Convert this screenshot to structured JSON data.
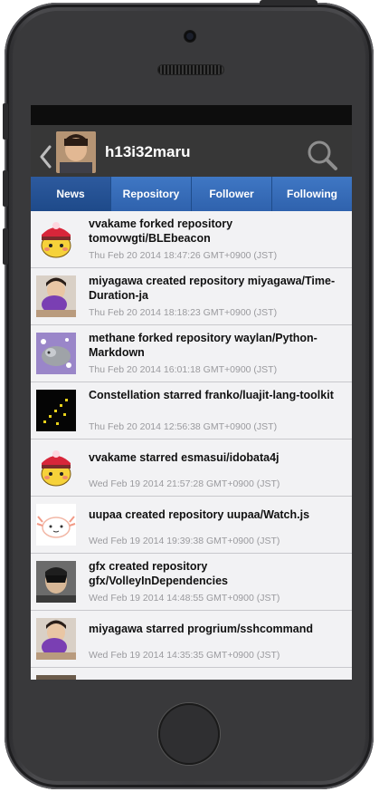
{
  "header": {
    "username": "h13i32maru"
  },
  "tabs": [
    {
      "label": "News",
      "active": true
    },
    {
      "label": "Repository",
      "active": false
    },
    {
      "label": "Follower",
      "active": false
    },
    {
      "label": "Following",
      "active": false
    }
  ],
  "feed": [
    {
      "title": "vvakame forked repository tomovwgti/BLEbeacon",
      "date": "Thu Feb 20 2014 18:47:26 GMT+0900 (JST)",
      "avatar": "yellow-mascot"
    },
    {
      "title": "miyagawa created repository miyagawa/Time-Duration-ja",
      "date": "Thu Feb 20 2014 18:18:23 GMT+0900 (JST)",
      "avatar": "person-purple"
    },
    {
      "title": "methane forked repository waylan/Python-Markdown",
      "date": "Thu Feb 20 2014 16:01:18 GMT+0900 (JST)",
      "avatar": "cat-plush"
    },
    {
      "title": "Constellation starred franko/luajit-lang-toolkit",
      "date": "Thu Feb 20 2014 12:56:38 GMT+0900 (JST)",
      "avatar": "constellation-dots"
    },
    {
      "title": "vvakame starred esmasui/idobata4j",
      "date": "Wed Feb 19 2014 21:57:28 GMT+0900 (JST)",
      "avatar": "yellow-mascot"
    },
    {
      "title": "uupaa created repository uupaa/Watch.js",
      "date": "Wed Feb 19 2014 19:39:38 GMT+0900 (JST)",
      "avatar": "axolotl-drawing"
    },
    {
      "title": "gfx created repository gfx/VolleyInDependencies",
      "date": "Wed Feb 19 2014 14:48:55 GMT+0900 (JST)",
      "avatar": "person-mask"
    },
    {
      "title": "miyagawa starred progrium/sshcommand",
      "date": "Wed Feb 19 2014 14:35:35 GMT+0900 (JST)",
      "avatar": "person-purple"
    }
  ],
  "colors": {
    "tab_bar": "#2f62ad",
    "nav_bar": "#373737",
    "list_bg": "#f2f2f4"
  }
}
